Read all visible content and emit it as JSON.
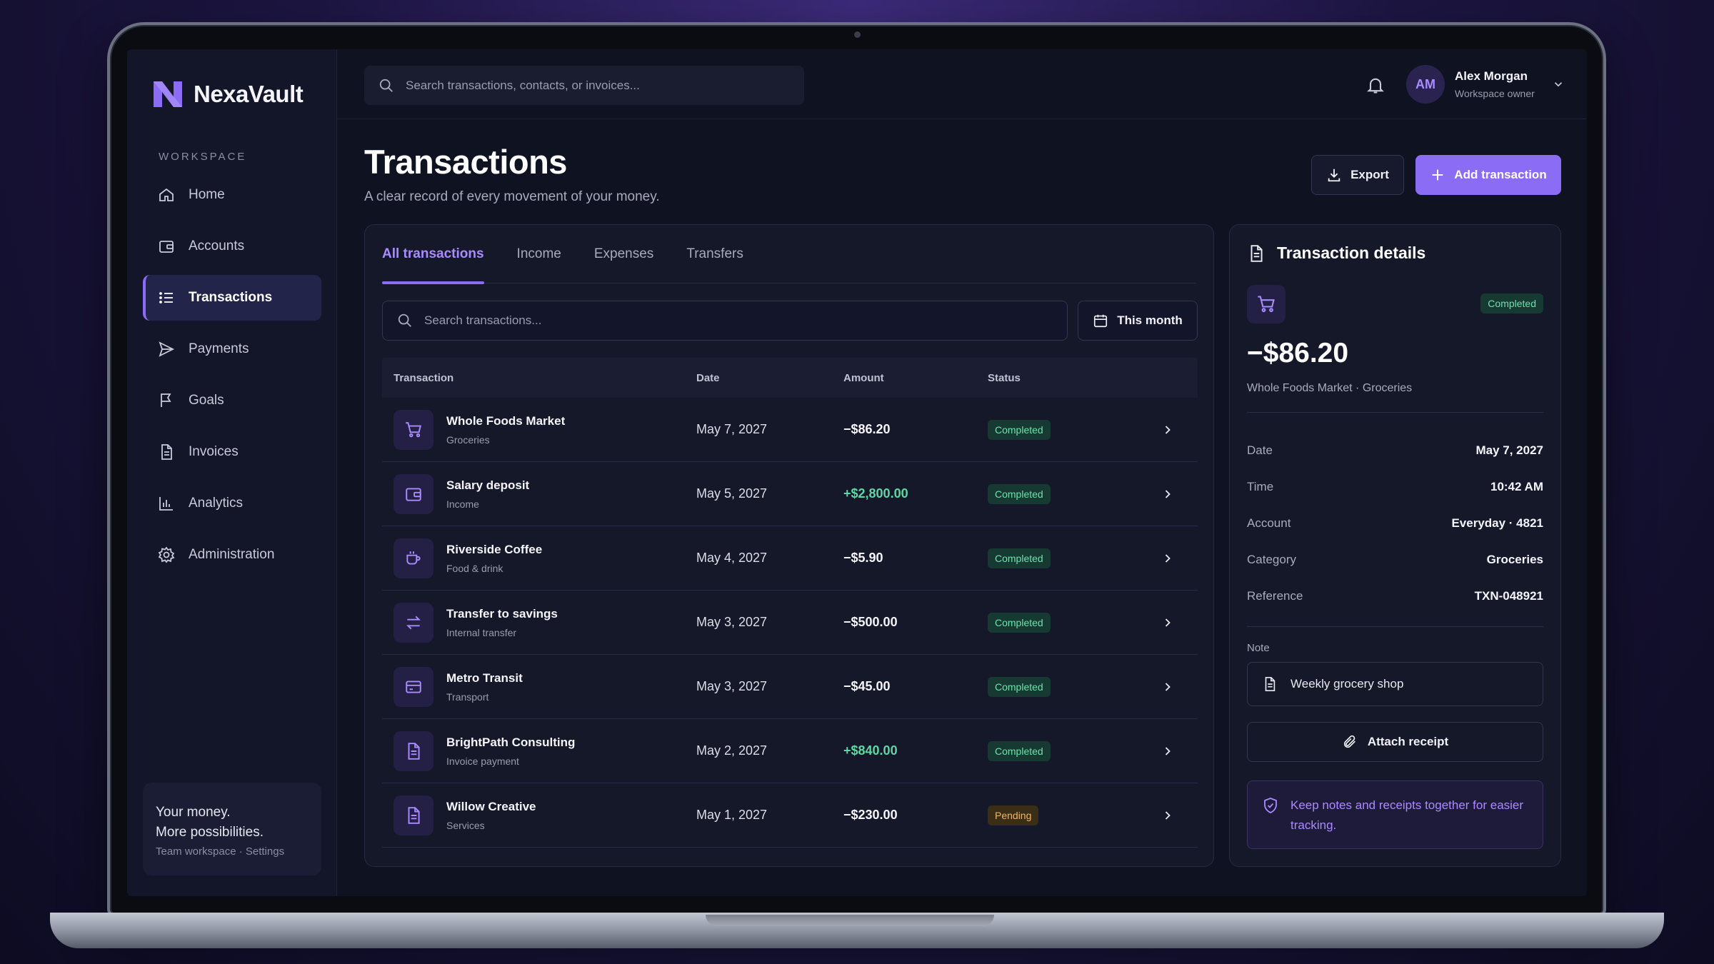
{
  "brand": {
    "name": "NexaVault",
    "accent": "#8b6cf5"
  },
  "sidebar": {
    "section_label": "WORKSPACE",
    "items": [
      {
        "label": "Home",
        "icon": "home-icon"
      },
      {
        "label": "Accounts",
        "icon": "wallet-icon"
      },
      {
        "label": "Transactions",
        "icon": "list-icon",
        "active": true
      },
      {
        "label": "Payments",
        "icon": "send-icon"
      },
      {
        "label": "Goals",
        "icon": "flag-icon"
      },
      {
        "label": "Invoices",
        "icon": "document-icon"
      },
      {
        "label": "Analytics",
        "icon": "bar-chart-icon"
      },
      {
        "label": "Administration",
        "icon": "gear-icon"
      }
    ],
    "promo": {
      "line1": "Your money.",
      "line2": "More possibilities.",
      "sub": "Team workspace · Settings"
    }
  },
  "topbar": {
    "search_placeholder": "Search transactions, contacts, or invoices...",
    "user": {
      "initials": "AM",
      "name": "Alex Morgan",
      "role": "Workspace owner"
    }
  },
  "page": {
    "title": "Transactions",
    "subtitle": "A clear record of every movement of your money.",
    "export_label": "Export",
    "add_label": "Add transaction"
  },
  "panel": {
    "tabs": [
      "All transactions",
      "Income",
      "Expenses",
      "Transfers"
    ],
    "active_tab": "All transactions",
    "search_placeholder": "Search transactions...",
    "period_label": "This month",
    "columns": [
      "Transaction",
      "Date",
      "Amount",
      "Status"
    ],
    "rows": [
      {
        "name": "Whole Foods Market",
        "category": "Groceries",
        "date": "May 7, 2027",
        "amount": "−$86.20",
        "positive": false,
        "status": "Completed",
        "icon": "cart-icon"
      },
      {
        "name": "Salary deposit",
        "category": "Income",
        "date": "May 5, 2027",
        "amount": "+$2,800.00",
        "positive": true,
        "status": "Completed",
        "icon": "wallet-icon"
      },
      {
        "name": "Riverside Coffee",
        "category": "Food & drink",
        "date": "May 4, 2027",
        "amount": "−$5.90",
        "positive": false,
        "status": "Completed",
        "icon": "coffee-icon"
      },
      {
        "name": "Transfer to savings",
        "category": "Internal transfer",
        "date": "May 3, 2027",
        "amount": "−$500.00",
        "positive": false,
        "status": "Completed",
        "icon": "transfer-icon"
      },
      {
        "name": "Metro Transit",
        "category": "Transport",
        "date": "May 3, 2027",
        "amount": "−$45.00",
        "positive": false,
        "status": "Completed",
        "icon": "card-icon"
      },
      {
        "name": "BrightPath Consulting",
        "category": "Invoice payment",
        "date": "May 2, 2027",
        "amount": "+$840.00",
        "positive": true,
        "status": "Completed",
        "icon": "document-icon"
      },
      {
        "name": "Willow Creative",
        "category": "Services",
        "date": "May 1, 2027",
        "amount": "−$230.00",
        "positive": false,
        "status": "Pending",
        "icon": "document-icon"
      }
    ]
  },
  "details": {
    "title": "Transaction details",
    "status": "Completed",
    "amount": "−$86.20",
    "merchant_line": "Whole Foods Market · Groceries",
    "fields": [
      {
        "key": "Date",
        "value": "May 7, 2027"
      },
      {
        "key": "Time",
        "value": "10:42 AM"
      },
      {
        "key": "Account",
        "value": "Everyday · 4821"
      },
      {
        "key": "Category",
        "value": "Groceries"
      },
      {
        "key": "Reference",
        "value": "TXN-048921"
      }
    ],
    "note_label": "Note",
    "note_value": "Weekly grocery shop",
    "attach_label": "Attach receipt",
    "tip": "Keep notes and receipts together for easier tracking."
  }
}
